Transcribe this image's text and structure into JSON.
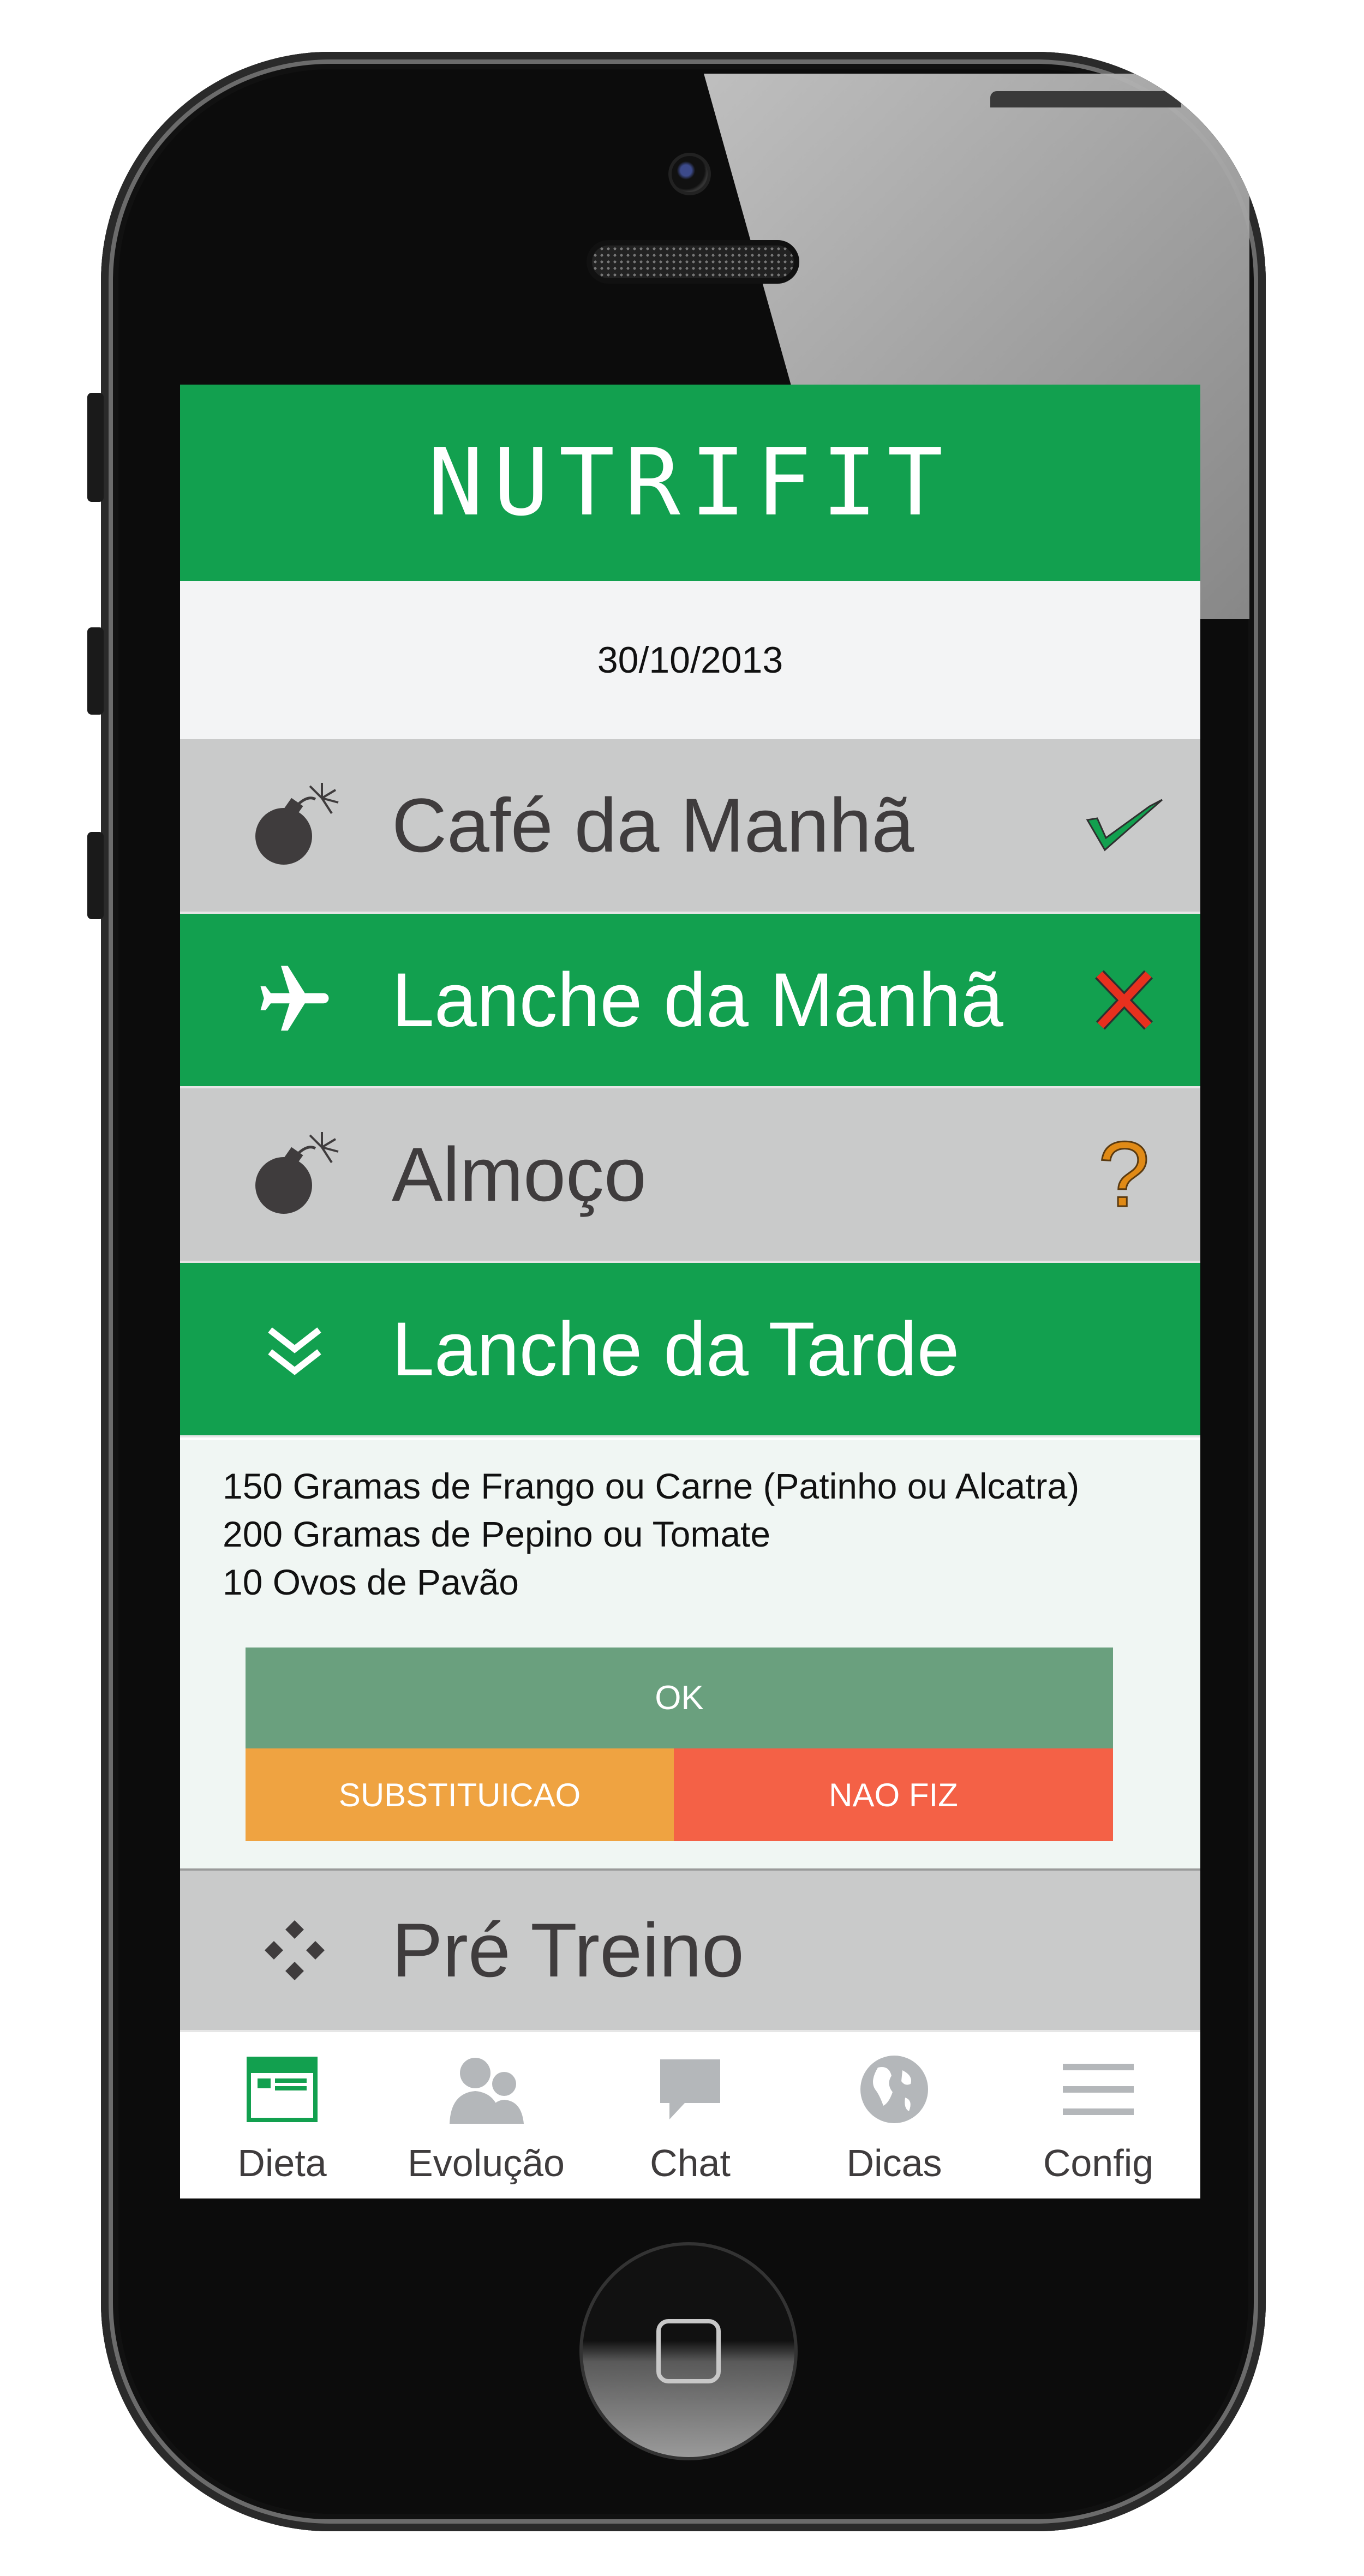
{
  "app": {
    "title": "NUTRIFIT"
  },
  "date": "30/10/2013",
  "meals": [
    {
      "label": "Café da Manhã",
      "icon": "bomb-icon",
      "status_icon": "checkmark-icon",
      "status_color": "#12a04f",
      "style": "gray"
    },
    {
      "label": "Lanche da Manhã",
      "icon": "airplane-icon",
      "status_icon": "x-icon",
      "status_color": "#e8301e",
      "style": "green"
    },
    {
      "label": "Almoço",
      "icon": "bomb-icon",
      "status_icon": "question-icon",
      "status_text": "?",
      "status_color": "#e08a16",
      "style": "gray"
    },
    {
      "label": "Lanche da Tarde",
      "icon": "chevron-double-down-icon",
      "style": "green",
      "expanded": true
    },
    {
      "label": "Pré Treino",
      "icon": "diamond-cluster-icon",
      "style": "gray"
    }
  ],
  "detail": {
    "lines": [
      "150 Gramas de Frango ou Carne (Patinho ou Alcatra)",
      "200 Gramas de Pepino ou Tomate",
      "10 Ovos de Pavão"
    ],
    "ok_label": "OK",
    "substitute_label": "SUBSTITUICAO",
    "not_done_label": "NAO FIZ"
  },
  "tabs": [
    {
      "label": "Dieta",
      "icon": "diet-card-icon",
      "active": true
    },
    {
      "label": "Evolução",
      "icon": "people-icon"
    },
    {
      "label": "Chat",
      "icon": "chat-bubble-icon"
    },
    {
      "label": "Dicas",
      "icon": "globe-icon"
    },
    {
      "label": "Config",
      "icon": "menu-lines-icon"
    }
  ],
  "colors": {
    "brand_green": "#12a04f",
    "row_gray": "#c9caca",
    "ok_green": "#6aa07e",
    "substitute_orange": "#efa341",
    "not_done_red": "#f46146",
    "tab_inactive": "#b4b7ba"
  }
}
